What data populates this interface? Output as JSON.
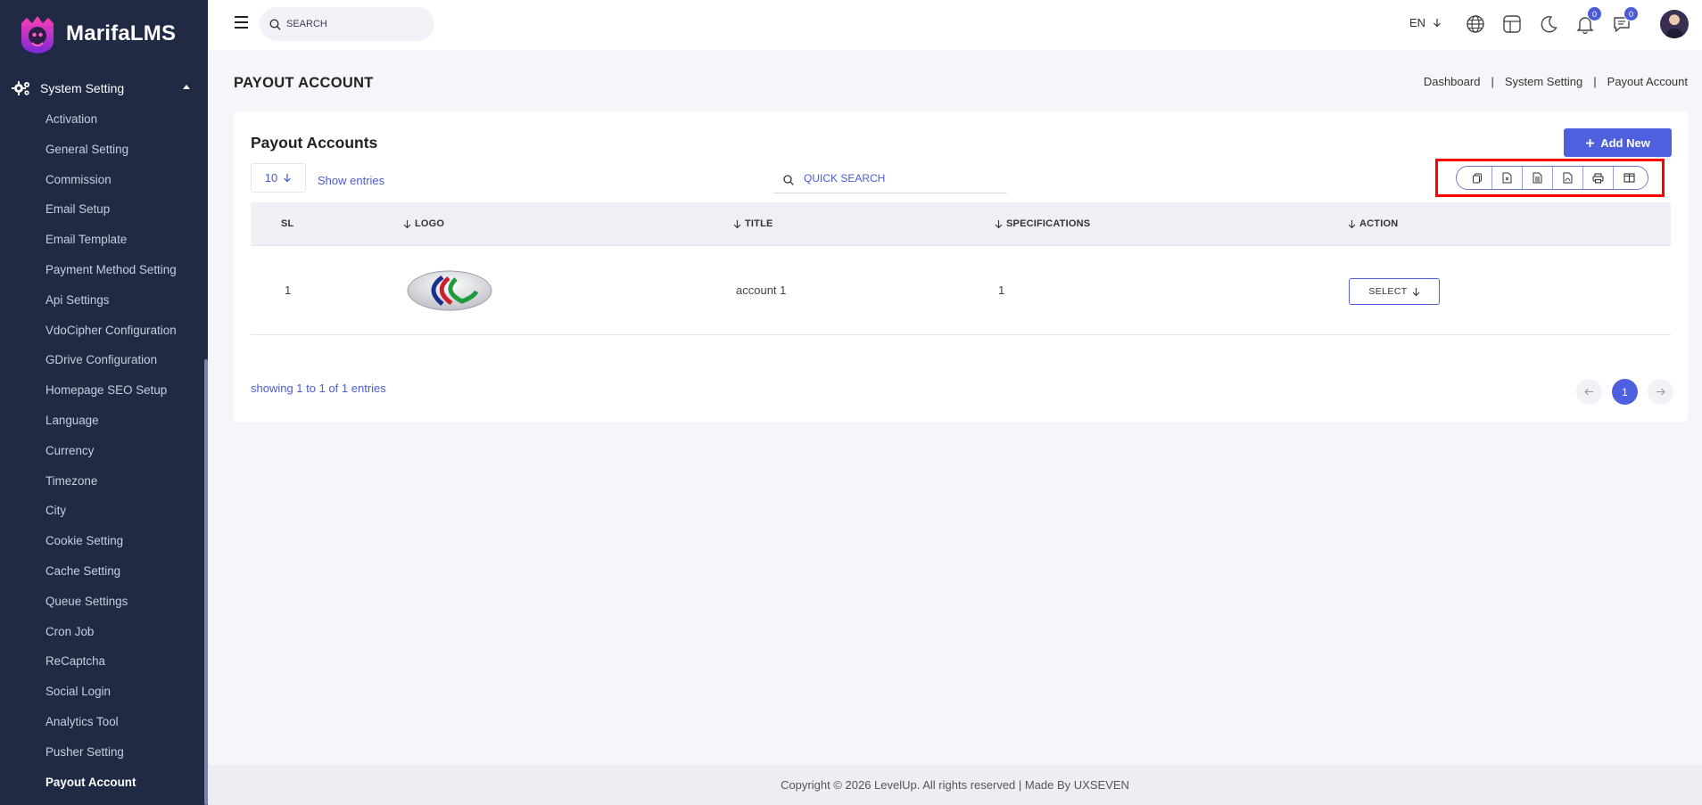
{
  "brand": {
    "name": "MarifaLMS"
  },
  "sidebar": {
    "group_label": "System Setting",
    "items": [
      {
        "label": "Activation"
      },
      {
        "label": "General Setting"
      },
      {
        "label": "Commission"
      },
      {
        "label": "Email Setup"
      },
      {
        "label": "Email Template"
      },
      {
        "label": "Payment Method Setting"
      },
      {
        "label": "Api Settings"
      },
      {
        "label": "VdoCipher Configuration"
      },
      {
        "label": "GDrive Configuration"
      },
      {
        "label": "Homepage SEO Setup"
      },
      {
        "label": "Language"
      },
      {
        "label": "Currency"
      },
      {
        "label": "Timezone"
      },
      {
        "label": "City"
      },
      {
        "label": "Cookie Setting"
      },
      {
        "label": "Cache Setting"
      },
      {
        "label": "Queue Settings"
      },
      {
        "label": "Cron Job"
      },
      {
        "label": "ReCaptcha"
      },
      {
        "label": "Social Login"
      },
      {
        "label": "Analytics Tool"
      },
      {
        "label": "Pusher Setting"
      },
      {
        "label": "Payout Account"
      }
    ],
    "active_item": "Payout Account"
  },
  "header": {
    "search_placeholder": "SEARCH",
    "language": "EN",
    "notifications_count": "0",
    "messages_count": "0"
  },
  "page": {
    "title": "PAYOUT ACCOUNT",
    "breadcrumb": [
      "Dashboard",
      "System Setting",
      "Payout Account"
    ],
    "breadcrumb_sep": "|"
  },
  "card": {
    "title": "Payout Accounts",
    "add_button": "Add New",
    "entries_value": "10",
    "show_entries": "Show entries",
    "quick_search_placeholder": "QUICK SEARCH",
    "export_buttons": [
      "copy-icon",
      "csv-icon",
      "excel-icon",
      "pdf-icon",
      "print-icon",
      "columns-icon"
    ]
  },
  "table": {
    "columns": [
      "SL",
      "LOGO",
      "TITLE",
      "SPECIFICATIONS",
      "ACTION"
    ],
    "rows": [
      {
        "sl": "1",
        "logo": "payout-logo",
        "title": "account 1",
        "specifications": "1",
        "action": "SELECT"
      }
    ],
    "summary": "showing 1 to 1 of 1 entries",
    "pagination": {
      "current_page": "1"
    }
  },
  "footer": {
    "text": "Copyright © 2026 LevelUp. All rights reserved | Made By UXSEVEN"
  },
  "colors": {
    "sidebar_bg": "#202a44",
    "accent": "#4e60de",
    "highlight": "#ff0000"
  }
}
